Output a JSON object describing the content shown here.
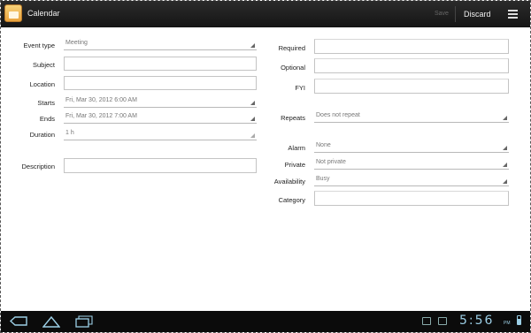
{
  "app": {
    "title": "Calendar",
    "save_label": "Save",
    "discard_label": "Discard",
    "accent": "#e9a23c"
  },
  "form": {
    "left": [
      {
        "key": "event_type",
        "label": "Event type",
        "value": "Meeting",
        "kind": "dropdown"
      },
      {
        "key": "subject",
        "label": "Subject",
        "value": "",
        "kind": "text"
      },
      {
        "key": "location",
        "label": "Location",
        "value": "",
        "kind": "text"
      },
      {
        "key": "starts",
        "label": "Starts",
        "value": "Fri, Mar 30, 2012 6:00 AM",
        "kind": "dropdown"
      },
      {
        "key": "ends",
        "label": "Ends",
        "value": "Fri, Mar 30, 2012 7:00 AM",
        "kind": "dropdown"
      },
      {
        "key": "duration",
        "label": "Duration",
        "value": "1 h",
        "kind": "dropdown-disabled"
      },
      {
        "key": "description",
        "label": "Description",
        "value": "",
        "kind": "text"
      }
    ],
    "right": [
      {
        "key": "required",
        "label": "Required",
        "value": "",
        "kind": "box"
      },
      {
        "key": "optional",
        "label": "Optional",
        "value": "",
        "kind": "box"
      },
      {
        "key": "fyi",
        "label": "FYI",
        "value": "",
        "kind": "box"
      },
      {
        "key": "repeats",
        "label": "Repeats",
        "value": "Does not repeat",
        "kind": "dropdown"
      },
      {
        "key": "alarm",
        "label": "Alarm",
        "value": "None",
        "kind": "dropdown"
      },
      {
        "key": "private",
        "label": "Private",
        "value": "Not private",
        "kind": "dropdown"
      },
      {
        "key": "availability",
        "label": "Availability",
        "value": "Busy",
        "kind": "dropdown"
      },
      {
        "key": "category",
        "label": "Category",
        "value": "",
        "kind": "box"
      }
    ]
  },
  "statusbar": {
    "time": "5:56",
    "ampm": "PM"
  },
  "icons": {
    "app": "calendar-icon",
    "menu": "overflow-menu-icon",
    "back": "back-icon",
    "home": "home-icon",
    "recent": "recent-apps-icon"
  }
}
